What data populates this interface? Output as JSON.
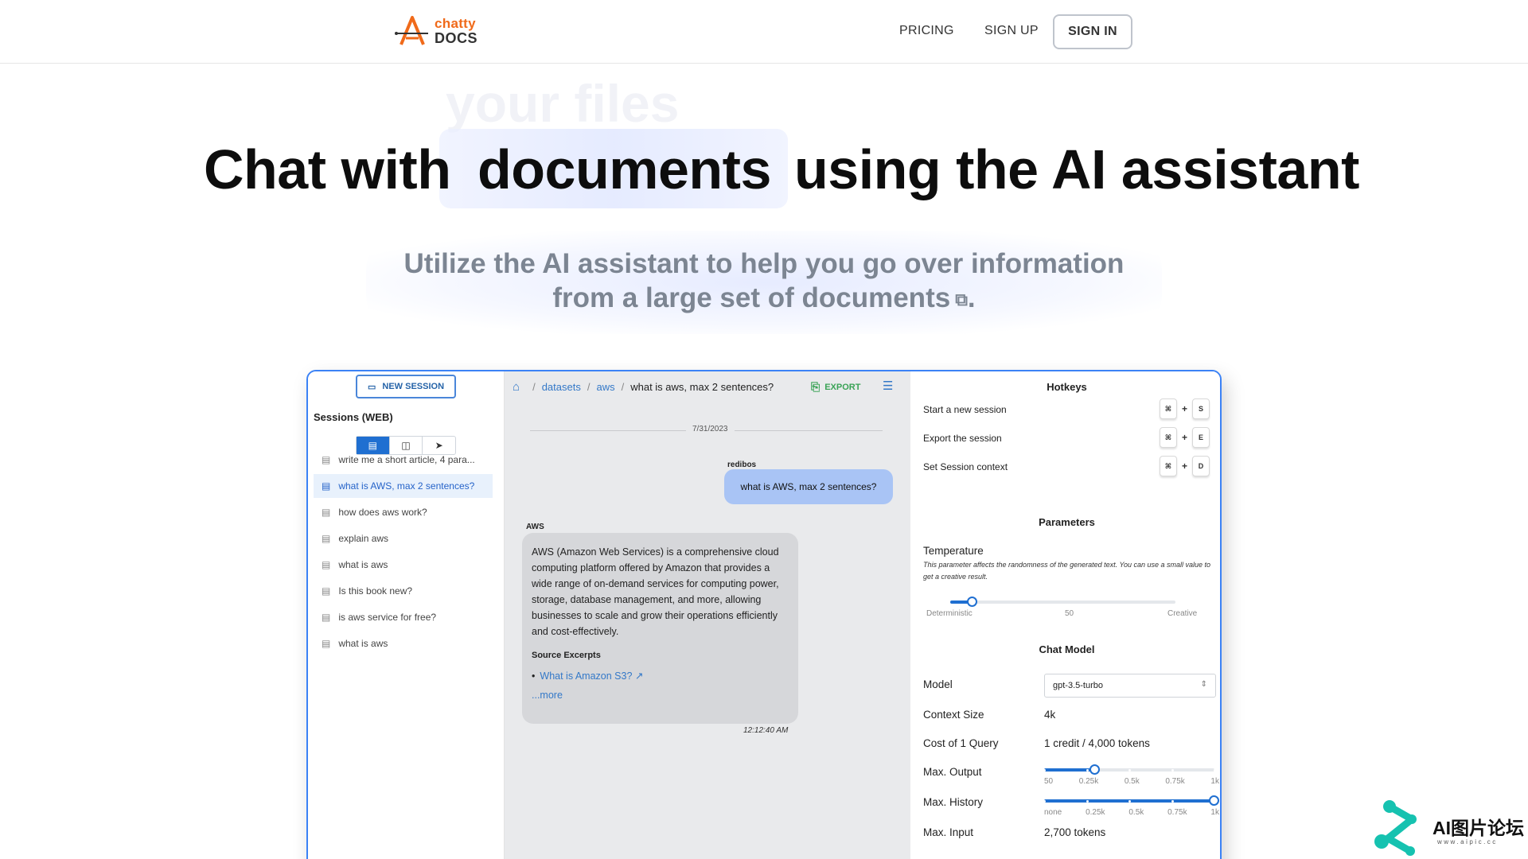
{
  "nav": {
    "logo_top": "chatty",
    "logo_bottom": "DOCS",
    "pricing": "PRICING",
    "sign_up": "SIGN UP",
    "sign_in": "SIGN IN"
  },
  "hero": {
    "ghost_word": "your files",
    "title_part1": "Chat with",
    "title_highlight": "documents",
    "title_part2": "using the AI assistant",
    "subtitle_line1": "Utilize the AI assistant to help you go over information",
    "subtitle_line2": "from a large set of documents",
    "subtitle_end": "."
  },
  "app": {
    "left": {
      "new_session": "NEW SESSION",
      "sessions_label": "Sessions (WEB)",
      "sessions": [
        "write me a short article, 4 para...",
        "what is AWS, max 2 sentences?",
        "how does aws work?",
        "explain aws",
        "what is aws",
        "Is this book new?",
        "is aws service for free?",
        "what is aws"
      ]
    },
    "mid": {
      "breadcrumb": [
        "datasets",
        "aws",
        "what is aws, max 2 sentences?"
      ],
      "export": "EXPORT",
      "date": "7/31/2023",
      "user_name": "redibos",
      "user_message": "what is AWS, max 2 sentences?",
      "ai_name": "AWS",
      "ai_message": "AWS (Amazon Web Services) is a comprehensive cloud computing platform offered by Amazon that provides a wide range of on-demand services for computing power, storage, database management, and more, allowing businesses to scale and grow their operations efficiently and cost-effectively.",
      "source_title": "Source Excerpts",
      "source_link": "What is Amazon S3?",
      "more": "...more",
      "time": "12:12:40 AM"
    },
    "right": {
      "hotkeys_title": "Hotkeys",
      "hotkeys": [
        {
          "label": "Start a new session",
          "mod": "⌘",
          "key": "S"
        },
        {
          "label": "Export the session",
          "mod": "⌘",
          "key": "E"
        },
        {
          "label": "Set Session context",
          "mod": "⌘",
          "key": "D"
        }
      ],
      "parameters_title": "Parameters",
      "temperature_label": "Temperature",
      "temperature_desc": "This parameter affects the randomness of the generated text. You can use a small value to get a creative result.",
      "temperature_value": 0.1,
      "temp_ticks": [
        "Deterministic",
        "50",
        "Creative"
      ],
      "chat_model_title": "Chat Model",
      "model_label": "Model",
      "model_value": "gpt-3.5-turbo",
      "context_label": "Context Size",
      "context_value": "4k",
      "cost_label": "Cost of 1 Query",
      "cost_value": "1 credit  /  4,000 tokens",
      "max_output_label": "Max. Output",
      "max_output_value": 0.3,
      "output_ticks": [
        "50",
        "0.25k",
        "0.5k",
        "0.75k",
        "1k"
      ],
      "max_history_label": "Max. History",
      "max_history_value": 1.0,
      "history_ticks": [
        "none",
        "0.25k",
        "0.5k",
        "0.75k",
        "1k"
      ],
      "max_input_label": "Max. Input",
      "max_input_value": "2,700 tokens"
    }
  },
  "watermark": {
    "text": "AI图片论坛",
    "url": "www.aipic.cc"
  },
  "colors": {
    "accent": "#1f6fd1",
    "logo_orange": "#f06a1a",
    "user_bubble": "#a9c4f5",
    "export_green": "#3aa356"
  }
}
